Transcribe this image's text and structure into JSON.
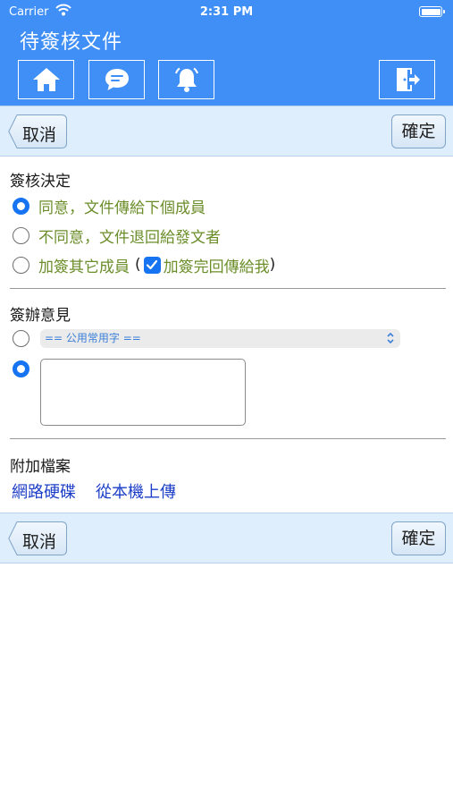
{
  "status_bar": {
    "carrier": "Carrier",
    "time": "2:31 PM"
  },
  "header": {
    "title": "待簽核文件",
    "icons": [
      "home-icon",
      "chat-icon",
      "bell-icon",
      "logout-icon"
    ]
  },
  "actions": {
    "cancel_label": "取消",
    "confirm_label": "確定"
  },
  "decision": {
    "title": "簽核決定",
    "options": [
      {
        "label": "同意，文件傳給下個成員",
        "selected": true
      },
      {
        "label": "不同意，文件退回給發文者",
        "selected": false
      },
      {
        "label": "加簽其它成員",
        "selected": false
      }
    ],
    "open_paren": "(",
    "return_checkbox_label": "加簽完回傳給我",
    "return_checked": true,
    "close_paren": ")"
  },
  "opinion": {
    "title": "簽辦意見",
    "phrase_select_value": "== 公用常用字 ==",
    "phrase_selected": false,
    "text_selected": true,
    "text_value": ""
  },
  "attachments": {
    "title": "附加檔案",
    "network_drive_label": "網路硬碟",
    "local_upload_label": "從本機上傳"
  },
  "colors": {
    "header_bg": "#3f8ff7",
    "bar_bg": "#dfeefc",
    "option_text": "#6b8e2a",
    "link": "#1d3fc7",
    "accent": "#1673f2"
  }
}
